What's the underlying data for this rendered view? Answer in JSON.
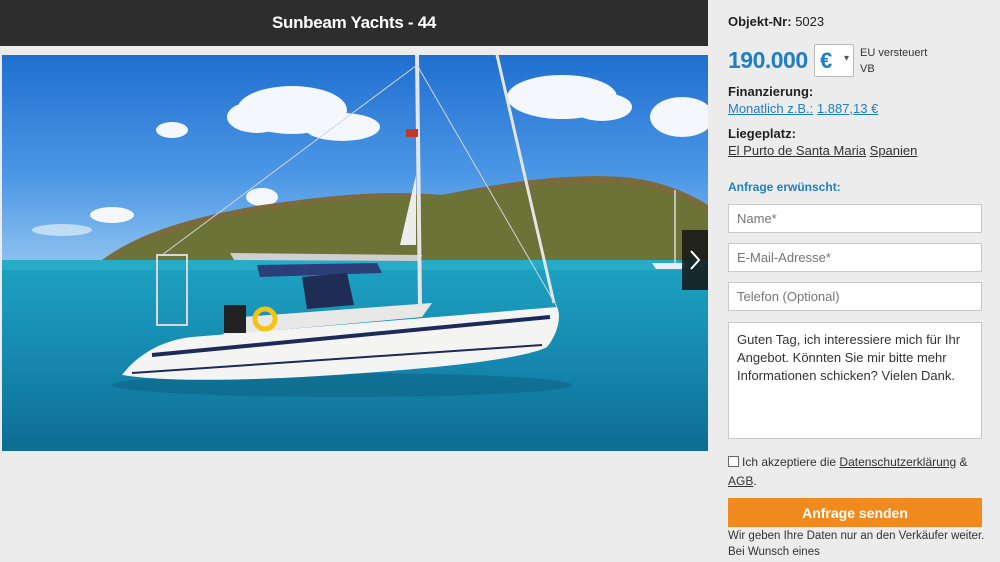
{
  "listing": {
    "title": "Sunbeam Yachts - 44",
    "object_label": "Objekt-Nr:",
    "object_number": "5023"
  },
  "price": {
    "amount": "190.000",
    "currency": "€",
    "currency_options": [
      "€"
    ],
    "tax_line1": "EU versteuert",
    "tax_line2": "VB",
    "accent_color": "#1f7fc4"
  },
  "financing": {
    "label": "Finanzierung:",
    "link_text": "Monatlich z.B.:",
    "amount": "1.887,13 €"
  },
  "berth": {
    "label": "Liegeplatz:",
    "place": "El Purto de Santa Maria",
    "country": "Spanien"
  },
  "form": {
    "heading": "Anfrage erwünscht:",
    "name_placeholder": "Name*",
    "email_placeholder": "E-Mail-Adresse*",
    "phone_placeholder": "Telefon (Optional)",
    "message_value": "Guten Tag, ich interessiere mich für Ihr Angebot. Könnten Sie mir bitte mehr Informationen schicken? Vielen Dank.",
    "consent_prefix": "Ich akzeptiere die",
    "privacy_link": "Datenschutzerklärung",
    "consent_amp": "&",
    "agb_link": "AGB",
    "consent_suffix": ".",
    "submit_label": "Anfrage senden",
    "submit_color": "#f08a1e",
    "note": "Wir geben Ihre Daten nur an den Verkäufer weiter. Bei Wunsch eines"
  },
  "gallery": {
    "next_icon": "chevron-right-icon"
  }
}
